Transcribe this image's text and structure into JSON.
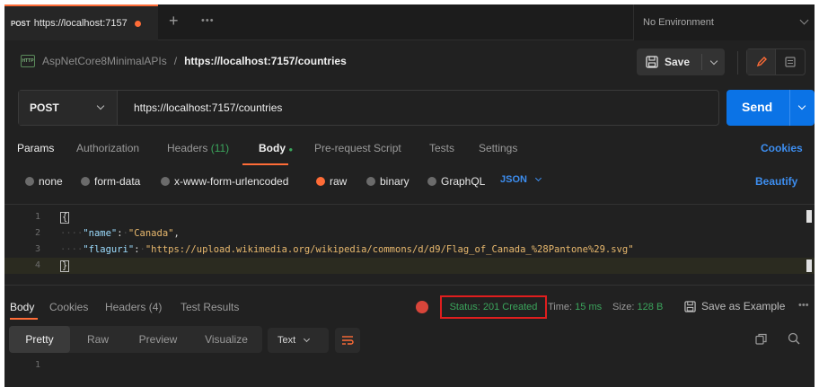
{
  "tab": {
    "method": "POST",
    "url": "https://localhost:7157"
  },
  "environment": {
    "label": "No Environment"
  },
  "breadcrumb": {
    "collection": "AspNetCore8MinimalAPIs",
    "separator": "/",
    "request": "https://localhost:7157/countries"
  },
  "toolbar": {
    "save_label": "Save"
  },
  "request": {
    "method": "POST",
    "url": "https://localhost:7157/countries",
    "send_label": "Send"
  },
  "request_tabs": [
    {
      "label": "Params"
    },
    {
      "label": "Authorization"
    },
    {
      "label": "Headers",
      "count": "(11)"
    },
    {
      "label": "Body",
      "dot": "●"
    },
    {
      "label": "Pre-request Script"
    },
    {
      "label": "Tests"
    },
    {
      "label": "Settings"
    }
  ],
  "cookies_label": "Cookies",
  "body_types": [
    "none",
    "form-data",
    "x-www-form-urlencoded",
    "raw",
    "binary",
    "GraphQL"
  ],
  "body_format": "JSON",
  "beautify_label": "Beautify",
  "editor": {
    "line_numbers": [
      "1",
      "2",
      "3",
      "4"
    ],
    "open_brace": "{",
    "close_brace": "}",
    "name_key": "\"name\"",
    "name_value": "\"Canada\"",
    "flag_key": "\"flaguri\"",
    "flag_value": "\"https://upload.wikimedia.org/wikipedia/commons/d/d9/Flag_of_Canada_%28Pantone%29.svg\"",
    "colon": ":",
    "comma": ","
  },
  "response": {
    "tabs": [
      {
        "label": "Body"
      },
      {
        "label": "Cookies"
      },
      {
        "label": "Headers",
        "count": "(4)"
      },
      {
        "label": "Test Results"
      }
    ],
    "status": "Status: 201 Created",
    "time_label": "Time:",
    "time_value": "15 ms",
    "size_label": "Size:",
    "size_value": "128 B",
    "save_example_label": "Save as Example",
    "view_modes": [
      "Pretty",
      "Raw",
      "Preview",
      "Visualize"
    ],
    "text_format": "Text",
    "line_numbers": [
      "1"
    ]
  },
  "colors": {
    "accent": "#ff6c37",
    "send": "#0b73e6",
    "link": "#3d8ef0",
    "success": "#3ba55c",
    "highlight_box": "#e01e1e"
  }
}
